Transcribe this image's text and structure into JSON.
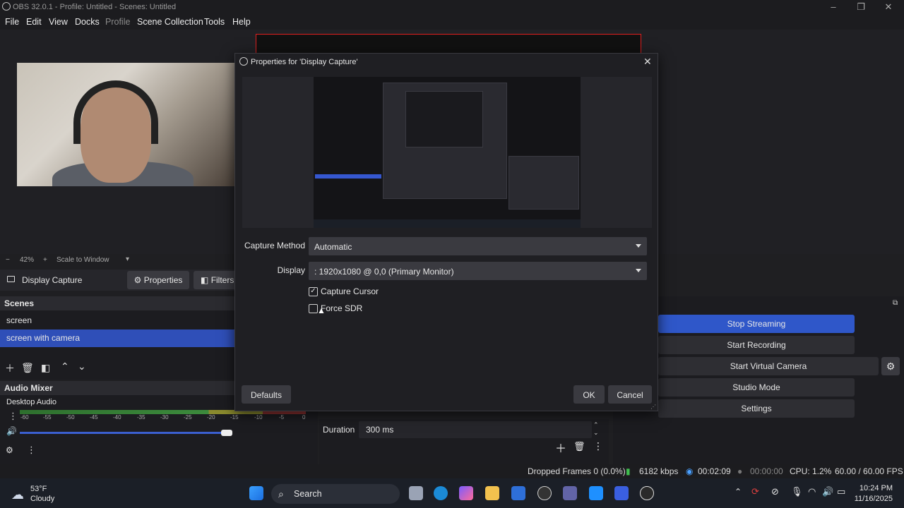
{
  "window": {
    "title": "OBS 32.0.1 - Profile: Untitled - Scenes: Untitled"
  },
  "menu": [
    "File",
    "Edit",
    "View",
    "Docks",
    "Profile",
    "Scene Collection",
    "Tools",
    "Help"
  ],
  "zoom": {
    "minus": "−",
    "level": "42%",
    "plus": "+",
    "mode": "Scale to Window"
  },
  "source_toolbar": {
    "source_name": "Display Capture",
    "properties_label": "Properties",
    "filters_label": "Filters"
  },
  "scenes": {
    "header": "Scenes",
    "items": [
      "screen",
      "screen with camera"
    ],
    "selected_index": 1
  },
  "audio_mixer": {
    "header": "Audio Mixer",
    "channel": "Desktop Audio",
    "ticks": [
      "-60",
      "-55",
      "-50",
      "-45",
      "-40",
      "-35",
      "-30",
      "-25",
      "-20",
      "-15",
      "-10",
      "-5",
      "0"
    ]
  },
  "transitions": {
    "duration_label": "Duration",
    "duration_value": "300 ms"
  },
  "controls": {
    "stop_streaming": "Stop Streaming",
    "start_recording": "Start Recording",
    "start_virtual_camera": "Start Virtual Camera",
    "studio_mode": "Studio Mode",
    "settings": "Settings"
  },
  "status": {
    "dropped_frames": "Dropped Frames 0 (0.0%)",
    "bitrate": "6182 kbps",
    "stream_time": "00:02:09",
    "rec_time": "00:00:00",
    "cpu": "CPU: 1.2%",
    "fps": "60.00 / 60.00 FPS"
  },
  "dialog": {
    "title": "Properties for 'Display Capture'",
    "capture_method_label": "Capture Method",
    "capture_method_value": "Automatic",
    "display_label": "Display",
    "display_value": ": 1920x1080 @ 0,0 (Primary Monitor)",
    "capture_cursor_label": "Capture Cursor",
    "capture_cursor_checked": true,
    "force_sdr_label": "Force SDR",
    "force_sdr_checked": false,
    "defaults_label": "Defaults",
    "ok_label": "OK",
    "cancel_label": "Cancel"
  },
  "taskbar": {
    "temperature": "53°F",
    "condition": "Cloudy",
    "search_label": "Search",
    "time": "10:24 PM",
    "date": "11/16/2025"
  },
  "colors": {
    "accent_blue": "#2f57c9",
    "recording_red": "#e02020"
  }
}
